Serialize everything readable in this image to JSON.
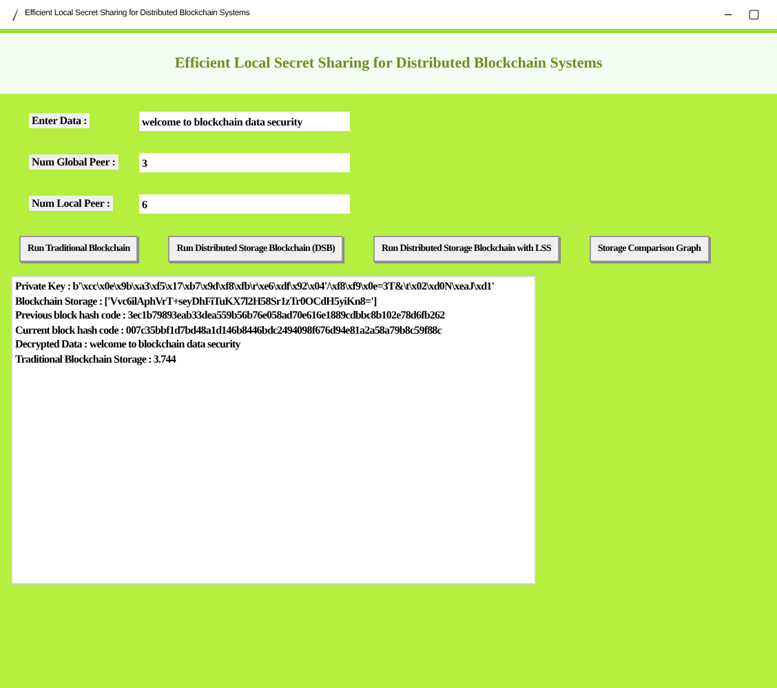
{
  "window": {
    "title": "Efficient Local Secret Sharing for Distributed Blockchain Systems",
    "controls": [
      "–",
      "▢"
    ]
  },
  "heading": "Efficient Local Secret Sharing for Distributed Blockchain Systems",
  "fields": [
    {
      "label": "Enter Data :",
      "value": "welcome to blockchain data security"
    },
    {
      "label": "Num Global Peer :",
      "value": "3"
    },
    {
      "label": "Num Local Peer :",
      "value": "6"
    }
  ],
  "buttons": [
    "Run Traditional Blockchain",
    "Run Distributed Storage Blockchain (DSB)",
    "Run Distributed Storage Blockchain with LSS",
    "Storage Comparison Graph"
  ],
  "output": [
    "Private Key : b'\\xcc\\x0e\\x9b\\xa3\\xf5\\x17\\xb7\\x9d\\xf8\\xfb\\r\\xe6\\xdf\\x92\\x04'/\\xf8\\xf9\\x0e=3T&\\t\\x02\\xd0N\\xeaJ\\xd1'",
    "Blockchain Storage : ['Vvc6ilAphVrT+seyDhFiTuKX7l2H58Sr1zTr0OCdH5yiKn8=']",
    "Previous block hash code : 3ec1b79893eab33dea559b56b76e058ad70e616e1889cdbbc8b102e78d6fb262",
    "Current block hash code : 007c35bbf1d7bd48a1d146b8446bdc2494098f676d94e81a2a58a79b8c59f88c",
    "Decrypted Data : welcome to blockchain data security",
    "Traditional Blockchain Storage : 3.744"
  ]
}
